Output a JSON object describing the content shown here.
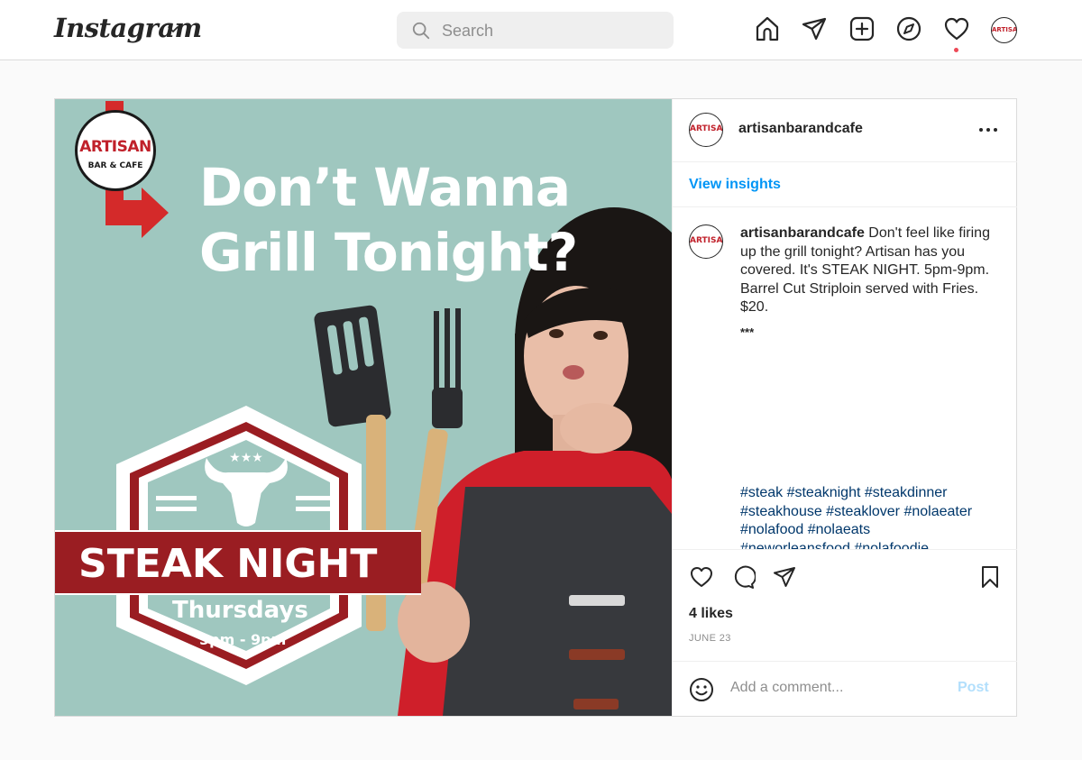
{
  "app": {
    "logo_text": "Instagram"
  },
  "search": {
    "placeholder": "Search"
  },
  "nav": {
    "icons": [
      "home-icon",
      "direct-message-icon",
      "new-post-icon",
      "explore-icon",
      "activity-heart-icon",
      "profile-avatar"
    ],
    "notification_color": "#ed4956"
  },
  "post_image": {
    "brand_name": "ARTISAN",
    "brand_sub": "BAR & CAFE",
    "headline_line1": "Don’t Wanna",
    "headline_line2": "Grill Tonight?",
    "banner": "STEAK NIGHT",
    "day": "Thursdays",
    "time": "5pm - 9pm",
    "colors": {
      "background": "#9fc7bf",
      "brand_red": "#9a1d22"
    }
  },
  "post": {
    "username": "artisanbarandcafe",
    "view_insights": "View insights",
    "caption_user": "artisanbarandcafe",
    "caption_body": "Don't feel like firing up the grill tonight? Artisan has you covered. It's STEAK NIGHT. 5pm-9pm. Barrel Cut Striploin served with Fries. $20.",
    "separator": "***",
    "hashtags": [
      "#steak #steaknight #steakdinner",
      "#steakhouse #steaklover #nolaeater",
      "#nolafood #nolaeats",
      "#neworleansfood #nolafoodie"
    ],
    "likes": "4 likes",
    "date": "JUNE 23",
    "comment_placeholder": "Add a comment...",
    "post_label": "Post",
    "link_color": "#0095f6",
    "hashtag_color": "#00376b"
  }
}
